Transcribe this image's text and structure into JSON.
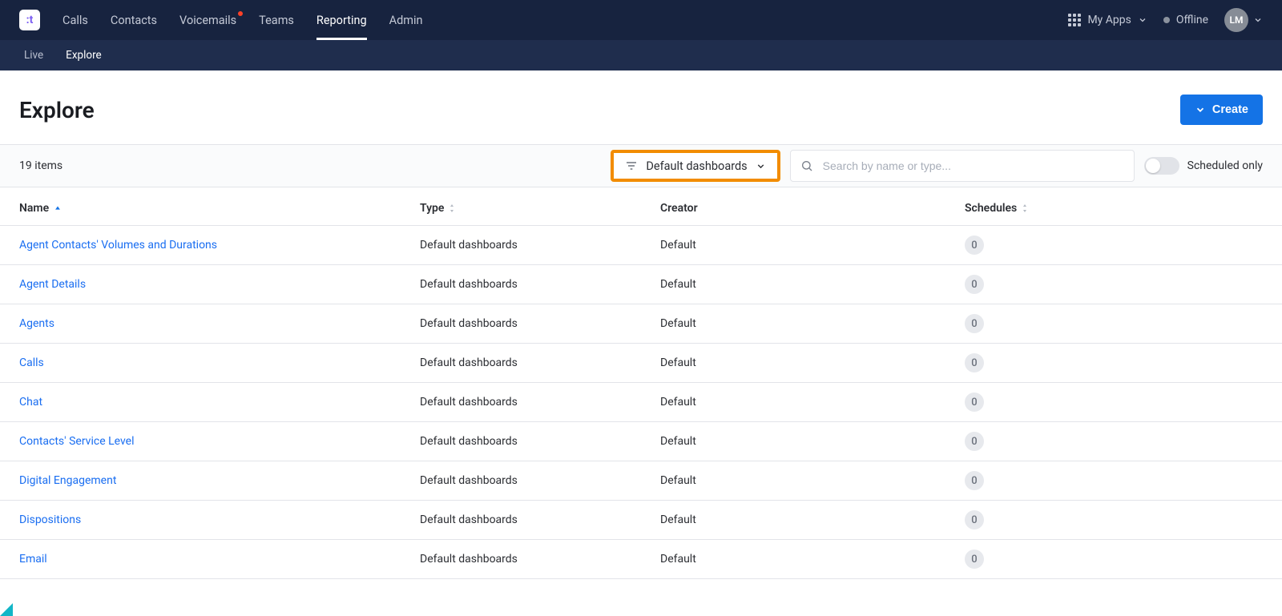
{
  "nav": {
    "items": [
      {
        "label": "Calls",
        "active": false,
        "notif": false
      },
      {
        "label": "Contacts",
        "active": false,
        "notif": false
      },
      {
        "label": "Voicemails",
        "active": false,
        "notif": true
      },
      {
        "label": "Teams",
        "active": false,
        "notif": false
      },
      {
        "label": "Reporting",
        "active": true,
        "notif": false
      },
      {
        "label": "Admin",
        "active": false,
        "notif": false
      }
    ],
    "my_apps_label": "My Apps",
    "status_label": "Offline",
    "avatar_initials": "LM"
  },
  "subnav": {
    "items": [
      {
        "label": "Live",
        "active": false
      },
      {
        "label": "Explore",
        "active": true
      }
    ]
  },
  "page": {
    "title": "Explore",
    "create_label": "Create"
  },
  "filterbar": {
    "items_count": "19 items",
    "filter_label": "Default dashboards",
    "search_placeholder": "Search by name or type...",
    "toggle_label": "Scheduled only"
  },
  "table": {
    "columns": {
      "name": "Name",
      "type": "Type",
      "creator": "Creator",
      "schedules": "Schedules"
    },
    "rows": [
      {
        "name": "Agent Contacts' Volumes and Durations",
        "type": "Default dashboards",
        "creator": "Default",
        "schedules": "0"
      },
      {
        "name": "Agent Details",
        "type": "Default dashboards",
        "creator": "Default",
        "schedules": "0"
      },
      {
        "name": "Agents",
        "type": "Default dashboards",
        "creator": "Default",
        "schedules": "0"
      },
      {
        "name": "Calls",
        "type": "Default dashboards",
        "creator": "Default",
        "schedules": "0"
      },
      {
        "name": "Chat",
        "type": "Default dashboards",
        "creator": "Default",
        "schedules": "0"
      },
      {
        "name": "Contacts' Service Level",
        "type": "Default dashboards",
        "creator": "Default",
        "schedules": "0"
      },
      {
        "name": "Digital Engagement",
        "type": "Default dashboards",
        "creator": "Default",
        "schedules": "0"
      },
      {
        "name": "Dispositions",
        "type": "Default dashboards",
        "creator": "Default",
        "schedules": "0"
      },
      {
        "name": "Email",
        "type": "Default dashboards",
        "creator": "Default",
        "schedules": "0"
      }
    ]
  }
}
